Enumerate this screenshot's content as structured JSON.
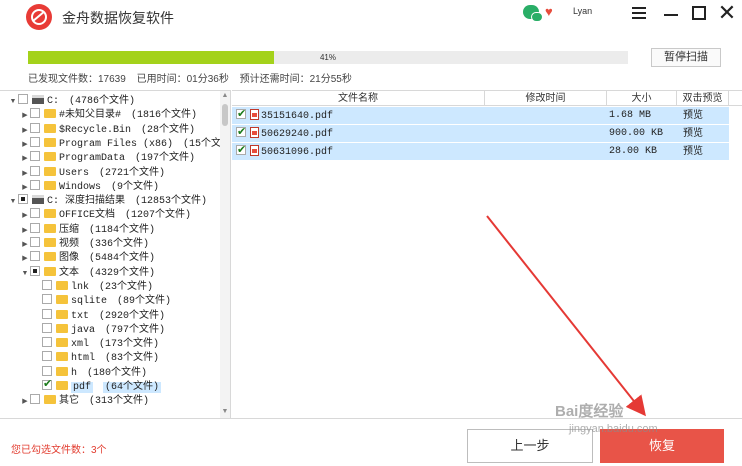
{
  "app": {
    "title": "金舟数据恢复软件",
    "user": "Lyan"
  },
  "colors": {
    "progress": "#a4d21b",
    "recover_button": "#e85448",
    "selection": "#cde8ff",
    "warning_text": "#e23c2f"
  },
  "scan": {
    "progress_percent": 41,
    "progress_label": "41%",
    "pause_label": "暂停扫描",
    "files_found": "已发现文件数：17639",
    "elapsed": "已用时间：01分36秒",
    "remaining": "预计还需时间：21分55秒"
  },
  "tree": {
    "rows": [
      {
        "arrow": "▼",
        "check": "",
        "icon": "drive",
        "name": "C:",
        "count": "(4786个文件)"
      },
      {
        "arrow": "▶",
        "check": "",
        "icon": "folder",
        "name": "#未知父目录#",
        "count": "(1816个文件)"
      },
      {
        "arrow": "▶",
        "check": "",
        "icon": "folder",
        "name": "$Recycle.Bin",
        "count": "(28个文件)"
      },
      {
        "arrow": "▶",
        "check": "",
        "icon": "folder",
        "name": "Program Files (x86)",
        "count": "(15个文"
      },
      {
        "arrow": "▶",
        "check": "",
        "icon": "folder",
        "name": "ProgramData",
        "count": "(197个文件)"
      },
      {
        "arrow": "▶",
        "check": "",
        "icon": "folder",
        "name": "Users",
        "count": "(2721个文件)"
      },
      {
        "arrow": "▶",
        "check": "",
        "icon": "folder",
        "name": "Windows",
        "count": "(9个文件)"
      },
      {
        "arrow": "▼",
        "check": "partial",
        "icon": "drive",
        "name": "C: 深度扫描结果",
        "count": "(12853个文件)"
      },
      {
        "arrow": "▶",
        "check": "",
        "icon": "folder",
        "name": "OFFICE文档",
        "count": "(1207个文件)"
      },
      {
        "arrow": "▶",
        "check": "",
        "icon": "folder",
        "name": "压缩",
        "count": "(1184个文件)"
      },
      {
        "arrow": "▶",
        "check": "",
        "icon": "folder",
        "name": "视频",
        "count": "(336个文件)"
      },
      {
        "arrow": "▶",
        "check": "",
        "icon": "folder",
        "name": "图像",
        "count": "(5484个文件)"
      },
      {
        "arrow": "▼",
        "check": "partial",
        "icon": "folder",
        "name": "文本",
        "count": "(4329个文件)"
      },
      {
        "arrow": "",
        "check": "",
        "icon": "folder",
        "name": "lnk",
        "count": "(23个文件)"
      },
      {
        "arrow": "",
        "check": "",
        "icon": "folder",
        "name": "sqlite",
        "count": "(89个文件)"
      },
      {
        "arrow": "",
        "check": "",
        "icon": "folder",
        "name": "txt",
        "count": "(2920个文件)"
      },
      {
        "arrow": "",
        "check": "",
        "icon": "folder",
        "name": "java",
        "count": "(797个文件)"
      },
      {
        "arrow": "",
        "check": "",
        "icon": "folder",
        "name": "xml",
        "count": "(173个文件)"
      },
      {
        "arrow": "",
        "check": "",
        "icon": "folder",
        "name": "html",
        "count": "(83个文件)"
      },
      {
        "arrow": "",
        "check": "",
        "icon": "folder",
        "name": "h",
        "count": "(180个文件)"
      },
      {
        "arrow": "",
        "check": "checked",
        "icon": "folder",
        "name": "pdf",
        "count": "(64个文件)"
      },
      {
        "arrow": "▶",
        "check": "",
        "icon": "folder",
        "name": "其它",
        "count": "(313个文件)"
      }
    ]
  },
  "table": {
    "headers": {
      "name": "文件名称",
      "modified": "修改时间",
      "size": "大小",
      "preview": "双击预览"
    },
    "rows": [
      {
        "name": "35151640.pdf",
        "size": "1.68 MB",
        "preview": "预览"
      },
      {
        "name": "50629240.pdf",
        "size": "900.00 KB",
        "preview": "预览"
      },
      {
        "name": "50631096.pdf",
        "size": "28.00 KB",
        "preview": "预览"
      }
    ]
  },
  "footer": {
    "selected": "您已勾选文件数：3个",
    "prev_label": "上一步",
    "recover_label": "恢复"
  },
  "watermark": {
    "brand": "Bai度经验",
    "url": "jingyan.baidu.com"
  }
}
